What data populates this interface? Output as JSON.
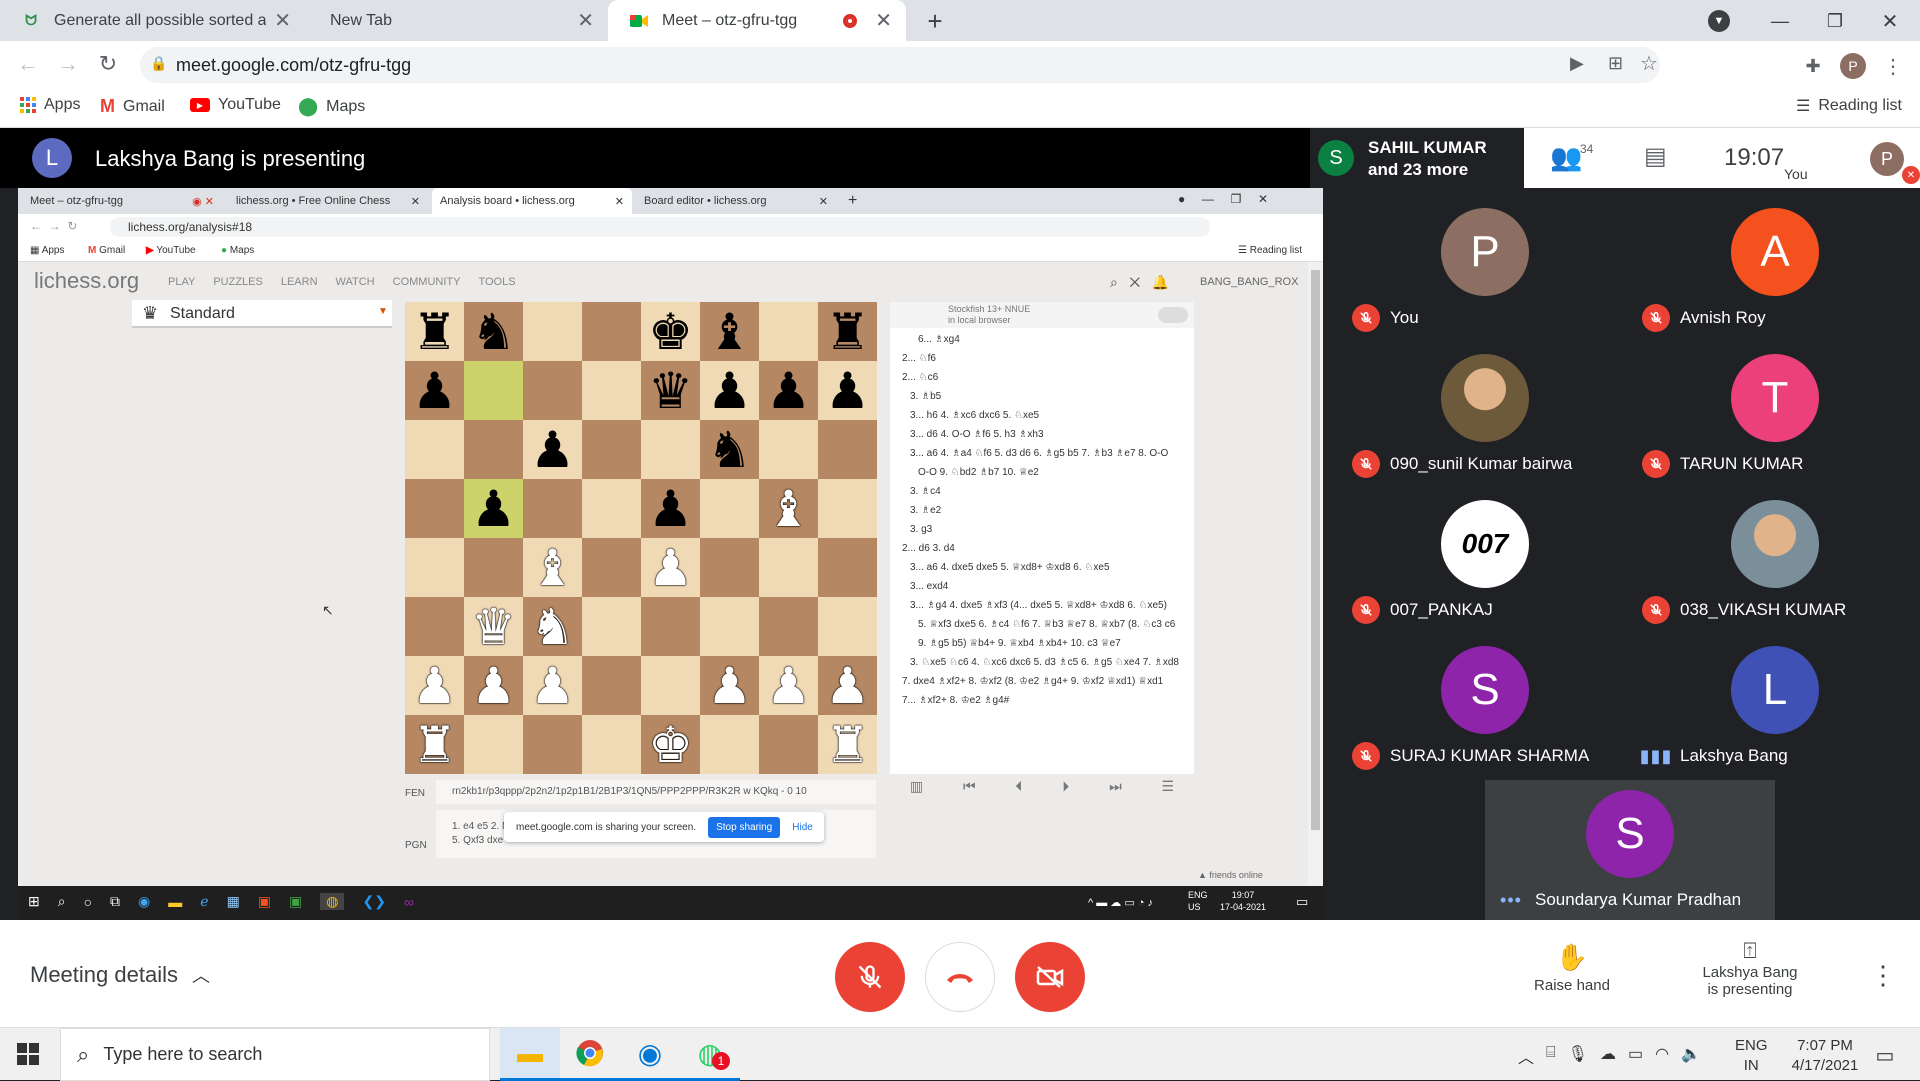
{
  "browser": {
    "tabs": [
      {
        "title": "Generate all possible sorted arra",
        "icon": "gfg-icon"
      },
      {
        "title": "New Tab",
        "icon": ""
      },
      {
        "title": "Meet – otz-gfru-tgg",
        "icon": "meet-icon"
      }
    ],
    "url": "meet.google.com/otz-gfru-tgg",
    "profile": "P",
    "bookmarks": [
      {
        "label": "Apps"
      },
      {
        "label": "Gmail"
      },
      {
        "label": "YouTube"
      },
      {
        "label": "Maps"
      }
    ],
    "reading_list": "Reading list"
  },
  "meet": {
    "presenter_initial": "L",
    "presenting_title": "Lakshya Bang is presenting",
    "header_initial": "S",
    "header_name": "SAHIL KUMAR",
    "header_more": "and 23 more",
    "people_count": "34",
    "clock": "19:07",
    "you_label": "You",
    "you_initial": "P",
    "participants": [
      {
        "name": "You",
        "initial": "P",
        "color": "#8d6e63",
        "muted": true
      },
      {
        "name": "Avnish Roy",
        "initial": "A",
        "color": "#f4511e",
        "muted": true
      },
      {
        "name": "090_sunil Kumar bairwa",
        "initial": "",
        "color": "#6d5a3a",
        "muted": true
      },
      {
        "name": "TARUN KUMAR",
        "initial": "T",
        "color": "#ec407a",
        "muted": true
      },
      {
        "name": "007_PANKAJ",
        "initial": "007",
        "color": "#ffffff",
        "muted": true
      },
      {
        "name": "038_VIKASH KUMAR",
        "initial": "",
        "color": "#7a8f9a",
        "muted": true
      },
      {
        "name": "SURAJ KUMAR SHARMA",
        "initial": "S",
        "color": "#8e24aa",
        "muted": true
      },
      {
        "name": "Lakshya Bang",
        "initial": "L",
        "color": "#3f51b5",
        "muted": false
      },
      {
        "name": "Soundarya Kumar Pradhan",
        "initial": "S",
        "color": "#8e24aa",
        "muted": false
      }
    ],
    "meeting_details": "Meeting details",
    "raise_hand": "Raise hand",
    "presenting_line1": "Lakshya Bang",
    "presenting_line2": "is presenting"
  },
  "shared": {
    "tabs": [
      {
        "title": "Meet – otz-gfru-tgg"
      },
      {
        "title": "lichess.org • Free Online Chess"
      },
      {
        "title": "Analysis board • lichess.org"
      },
      {
        "title": "Board editor • lichess.org"
      }
    ],
    "url": "lichess.org/analysis#18",
    "bookmarks": [
      "Apps",
      "Gmail",
      "YouTube",
      "Maps"
    ],
    "reading_list": "Reading list",
    "logo": "lichess.org",
    "nav": [
      "PLAY",
      "PUZZLES",
      "LEARN",
      "WATCH",
      "COMMUNITY",
      "TOOLS"
    ],
    "user": "BANG_BANG_ROX",
    "variant": "Standard",
    "engine_name": "Stockfish 13+ NNUE",
    "engine_sub": "in local browser",
    "board": [
      [
        "r",
        "n",
        "",
        "",
        "k",
        "b",
        "",
        "r"
      ],
      [
        "p",
        "",
        "",
        "",
        "q",
        "p",
        "p",
        "p"
      ],
      [
        "",
        "",
        "p",
        "",
        "",
        "n",
        "",
        ""
      ],
      [
        "",
        "p",
        "",
        "",
        "p",
        "",
        "B",
        ""
      ],
      [
        "",
        "",
        "B",
        "",
        "P",
        "",
        "",
        ""
      ],
      [
        "",
        "Q",
        "N",
        "",
        "",
        "",
        "",
        ""
      ],
      [
        "P",
        "P",
        "P",
        "",
        "",
        "P",
        "P",
        "P"
      ],
      [
        "R",
        "",
        "",
        "",
        "K",
        "",
        "",
        "R"
      ]
    ],
    "moves": [
      "6... ♗xg4",
      "2... ♘f6",
      "2... ♘c6",
      "3. ♗b5",
      "3... h6 4. ♗xc6 dxc6 5. ♘xe5",
      "3... d6 4. O-O ♗f6 5. h3 ♗xh3",
      "3... a6 4. ♗a4 ♘f6 5. d3 d6 6. ♗g5 b5 7. ♗b3 ♗e7 8. O-O",
      "O-O 9. ♘bd2 ♗b7 10. ♕e2",
      "3. ♗c4",
      "3. ♗e2",
      "3. g3",
      "2... d6 3. d4",
      "3... a6 4. dxe5 dxe5 5. ♕xd8+ ♔xd8 6. ♘xe5",
      "3... exd4",
      "3... ♗g4 4. dxe5 ♗xf3 (4... dxe5 5. ♕xd8+ ♔xd8 6. ♘xe5)",
      "5. ♕xf3 dxe5 6. ♗c4 ♘f6 7. ♕b3 ♕e7 8. ♕xb7 (8. ♘c3 c6",
      "9. ♗g5 b5) ♕b4+ 9. ♕xb4 ♗xb4+ 10. c3 ♕e7",
      "3. ♘xe5 ♘c6 4. ♘xc6 dxc6 5. d3 ♗c5 6. ♗g5 ♘xe4 7. ♗xd8",
      "7. dxe4 ♗xf2+ 8. ♔xf2 (8. ♔e2 ♗g4+ 9. ♔xf2 ♕xd1) ♕xd1",
      "7... ♗xf2+ 8. ♔e2 ♗g4#"
    ],
    "fen_label": "FEN",
    "fen": "rn2kb1r/p3qppp/2p2n2/1p2p1B1/2B1P3/1QN5/PPP2PPP/R3K2R w KQkq - 0 10",
    "pgn_label": "PGN",
    "pgn_1": "1. e4 e5 2. N",
    "pgn_2": "5. Qxf3 dxe",
    "share_msg": "meet.google.com is sharing your screen.",
    "stop_sharing": "Stop sharing",
    "hide": "Hide",
    "friends": "▲ friends online",
    "tray_lang1": "ENG",
    "tray_lang2": "US",
    "tray_time": "19:07",
    "tray_date": "17-04-2021"
  },
  "taskbar": {
    "search_placeholder": "Type here to search",
    "lang1": "ENG",
    "lang2": "IN",
    "time": "7:07 PM",
    "date": "4/17/2021",
    "whatsapp_badge": "1"
  }
}
